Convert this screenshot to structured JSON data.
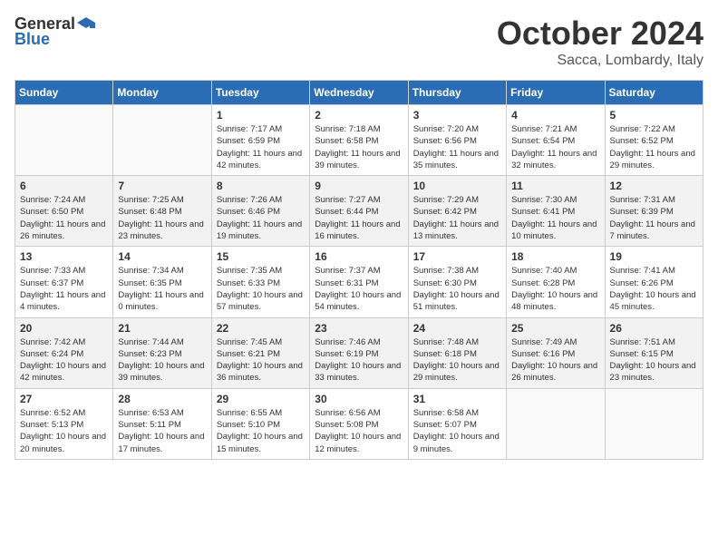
{
  "header": {
    "logo_general": "General",
    "logo_blue": "Blue",
    "month_title": "October 2024",
    "location": "Sacca, Lombardy, Italy"
  },
  "days_of_week": [
    "Sunday",
    "Monday",
    "Tuesday",
    "Wednesday",
    "Thursday",
    "Friday",
    "Saturday"
  ],
  "weeks": [
    [
      {
        "day": "",
        "info": ""
      },
      {
        "day": "",
        "info": ""
      },
      {
        "day": "1",
        "info": "Sunrise: 7:17 AM\nSunset: 6:59 PM\nDaylight: 11 hours and 42 minutes."
      },
      {
        "day": "2",
        "info": "Sunrise: 7:18 AM\nSunset: 6:58 PM\nDaylight: 11 hours and 39 minutes."
      },
      {
        "day": "3",
        "info": "Sunrise: 7:20 AM\nSunset: 6:56 PM\nDaylight: 11 hours and 35 minutes."
      },
      {
        "day": "4",
        "info": "Sunrise: 7:21 AM\nSunset: 6:54 PM\nDaylight: 11 hours and 32 minutes."
      },
      {
        "day": "5",
        "info": "Sunrise: 7:22 AM\nSunset: 6:52 PM\nDaylight: 11 hours and 29 minutes."
      }
    ],
    [
      {
        "day": "6",
        "info": "Sunrise: 7:24 AM\nSunset: 6:50 PM\nDaylight: 11 hours and 26 minutes."
      },
      {
        "day": "7",
        "info": "Sunrise: 7:25 AM\nSunset: 6:48 PM\nDaylight: 11 hours and 23 minutes."
      },
      {
        "day": "8",
        "info": "Sunrise: 7:26 AM\nSunset: 6:46 PM\nDaylight: 11 hours and 19 minutes."
      },
      {
        "day": "9",
        "info": "Sunrise: 7:27 AM\nSunset: 6:44 PM\nDaylight: 11 hours and 16 minutes."
      },
      {
        "day": "10",
        "info": "Sunrise: 7:29 AM\nSunset: 6:42 PM\nDaylight: 11 hours and 13 minutes."
      },
      {
        "day": "11",
        "info": "Sunrise: 7:30 AM\nSunset: 6:41 PM\nDaylight: 11 hours and 10 minutes."
      },
      {
        "day": "12",
        "info": "Sunrise: 7:31 AM\nSunset: 6:39 PM\nDaylight: 11 hours and 7 minutes."
      }
    ],
    [
      {
        "day": "13",
        "info": "Sunrise: 7:33 AM\nSunset: 6:37 PM\nDaylight: 11 hours and 4 minutes."
      },
      {
        "day": "14",
        "info": "Sunrise: 7:34 AM\nSunset: 6:35 PM\nDaylight: 11 hours and 0 minutes."
      },
      {
        "day": "15",
        "info": "Sunrise: 7:35 AM\nSunset: 6:33 PM\nDaylight: 10 hours and 57 minutes."
      },
      {
        "day": "16",
        "info": "Sunrise: 7:37 AM\nSunset: 6:31 PM\nDaylight: 10 hours and 54 minutes."
      },
      {
        "day": "17",
        "info": "Sunrise: 7:38 AM\nSunset: 6:30 PM\nDaylight: 10 hours and 51 minutes."
      },
      {
        "day": "18",
        "info": "Sunrise: 7:40 AM\nSunset: 6:28 PM\nDaylight: 10 hours and 48 minutes."
      },
      {
        "day": "19",
        "info": "Sunrise: 7:41 AM\nSunset: 6:26 PM\nDaylight: 10 hours and 45 minutes."
      }
    ],
    [
      {
        "day": "20",
        "info": "Sunrise: 7:42 AM\nSunset: 6:24 PM\nDaylight: 10 hours and 42 minutes."
      },
      {
        "day": "21",
        "info": "Sunrise: 7:44 AM\nSunset: 6:23 PM\nDaylight: 10 hours and 39 minutes."
      },
      {
        "day": "22",
        "info": "Sunrise: 7:45 AM\nSunset: 6:21 PM\nDaylight: 10 hours and 36 minutes."
      },
      {
        "day": "23",
        "info": "Sunrise: 7:46 AM\nSunset: 6:19 PM\nDaylight: 10 hours and 33 minutes."
      },
      {
        "day": "24",
        "info": "Sunrise: 7:48 AM\nSunset: 6:18 PM\nDaylight: 10 hours and 29 minutes."
      },
      {
        "day": "25",
        "info": "Sunrise: 7:49 AM\nSunset: 6:16 PM\nDaylight: 10 hours and 26 minutes."
      },
      {
        "day": "26",
        "info": "Sunrise: 7:51 AM\nSunset: 6:15 PM\nDaylight: 10 hours and 23 minutes."
      }
    ],
    [
      {
        "day": "27",
        "info": "Sunrise: 6:52 AM\nSunset: 5:13 PM\nDaylight: 10 hours and 20 minutes."
      },
      {
        "day": "28",
        "info": "Sunrise: 6:53 AM\nSunset: 5:11 PM\nDaylight: 10 hours and 17 minutes."
      },
      {
        "day": "29",
        "info": "Sunrise: 6:55 AM\nSunset: 5:10 PM\nDaylight: 10 hours and 15 minutes."
      },
      {
        "day": "30",
        "info": "Sunrise: 6:56 AM\nSunset: 5:08 PM\nDaylight: 10 hours and 12 minutes."
      },
      {
        "day": "31",
        "info": "Sunrise: 6:58 AM\nSunset: 5:07 PM\nDaylight: 10 hours and 9 minutes."
      },
      {
        "day": "",
        "info": ""
      },
      {
        "day": "",
        "info": ""
      }
    ]
  ]
}
